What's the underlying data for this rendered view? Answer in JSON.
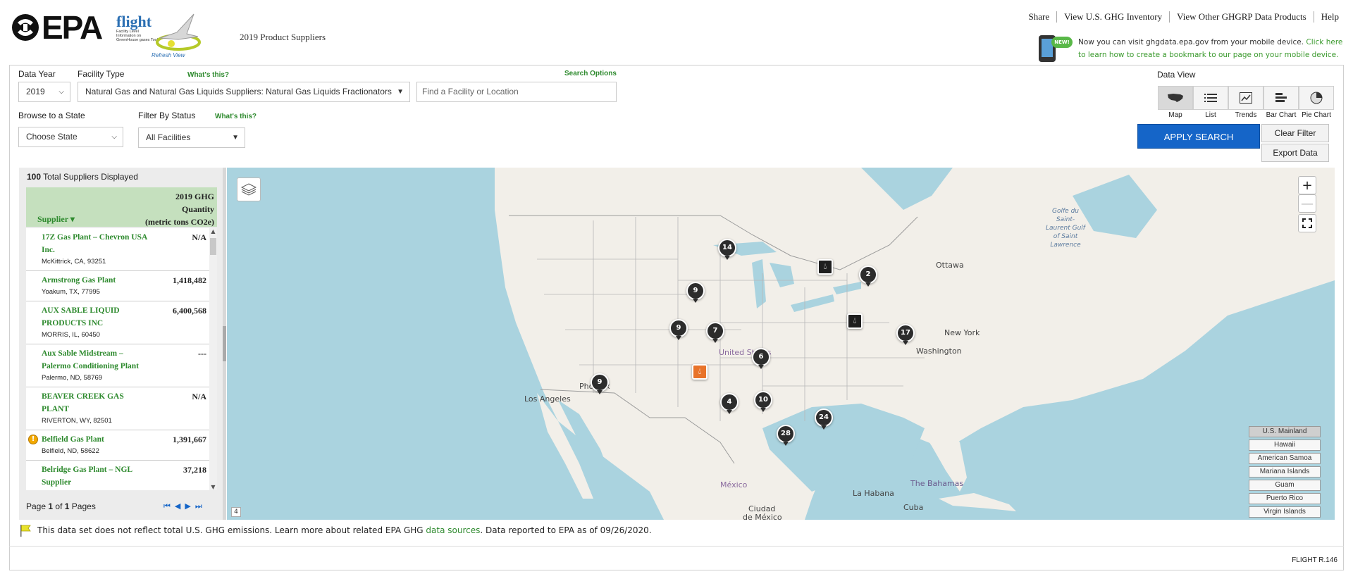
{
  "header": {
    "epa_text": "EPA",
    "flight_word": "flight",
    "flight_subtitle": "Facility Level Information on GreenHouse gases Tool",
    "refresh_view": "Refresh View",
    "page_title": "2019 Product Suppliers",
    "links": [
      "Share",
      "View U.S. GHG Inventory",
      "View Other GHGRP Data Products",
      "Help"
    ],
    "mobile_badge": "NEW!",
    "mobile_text": "Now you can visit ghgdata.epa.gov from your mobile device.",
    "mobile_link": "Click here to learn how to create a bookmark to our page on your mobile device."
  },
  "filters": {
    "data_year_label": "Data Year",
    "data_year_value": "2019",
    "facility_type_label": "Facility Type",
    "whats_this": "What's this?",
    "facility_type_value": "Natural Gas and Natural Gas Liquids Suppliers: Natural Gas Liquids Fractionators",
    "search_options": "Search Options",
    "search_placeholder": "Find a Facility or Location",
    "browse_state_label": "Browse to a State",
    "browse_state_value": "Choose State",
    "filter_status_label": "Filter By Status",
    "filter_status_value": "All Facilities",
    "data_view_label": "Data View",
    "views": [
      "Map",
      "List",
      "Trends",
      "Bar Chart",
      "Pie Chart"
    ],
    "active_view": "Map",
    "apply_label": "APPLY SEARCH",
    "clear_label": "Clear Filter",
    "export_label": "Export Data"
  },
  "list": {
    "count": "100",
    "count_suffix": "Total Suppliers Displayed",
    "supplier_header": "Supplier",
    "qty_header_1": "2019 GHG",
    "qty_header_2": "Quantity",
    "qty_header_3": "(metric tons CO2e)",
    "rows": [
      {
        "name": "17Z Gas Plant – Chevron USA Inc.",
        "loc": "McKittrick, CA, 93251",
        "qty": "N/A",
        "warn": false
      },
      {
        "name": "Armstrong Gas Plant",
        "loc": "Yoakum, TX, 77995",
        "qty": "1,418,482",
        "warn": false
      },
      {
        "name": "AUX SABLE LIQUID PRODUCTS INC",
        "loc": "MORRIS, IL, 60450",
        "qty": "6,400,568",
        "warn": false
      },
      {
        "name": "Aux Sable Midstream – Palermo Conditioning Plant",
        "loc": "Palermo, ND, 58769",
        "qty": "---",
        "warn": false
      },
      {
        "name": "BEAVER CREEK GAS PLANT",
        "loc": "RIVERTON, WY, 82501",
        "qty": "N/A",
        "warn": false
      },
      {
        "name": "Belfield Gas Plant",
        "loc": "Belfield, ND, 58622",
        "qty": "1,391,667",
        "warn": true
      },
      {
        "name": "Belridge Gas Plant – NGL Supplier",
        "loc": "",
        "qty": "37,218",
        "warn": false
      }
    ],
    "page_label": "Page",
    "page_current": "1",
    "page_of": "of",
    "page_total": "1",
    "pages_label": "Pages"
  },
  "map": {
    "labels": {
      "ottawa": "Ottawa",
      "newyork": "New York",
      "washington": "Washington",
      "unitedstates": "United States",
      "phoenix": "Phoenix",
      "losangeles": "Los Angeles",
      "mexico": "México",
      "ciudad": "Ciudad",
      "demexico": "de México",
      "lahabana": "La Habana",
      "bahamas": "The Bahamas",
      "cuba": "Cuba",
      "golfe": "Golfe du Saint-Laurent Gulf of Saint Lawrence"
    },
    "clusters": [
      "14",
      "9",
      "2",
      "9",
      "7",
      "17",
      "6",
      "9",
      "4",
      "10",
      "24",
      "28"
    ],
    "zoom_level": "4",
    "regions": [
      "U.S. Mainland",
      "Hawaii",
      "American Samoa",
      "Mariana Islands",
      "Guam",
      "Puerto Rico",
      "Virgin Islands"
    ],
    "active_region": "U.S. Mainland"
  },
  "footer": {
    "disclaimer_1": "This data set does not reflect total U.S. GHG emissions. Learn more about related EPA GHG",
    "data_sources": "data sources",
    "disclaimer_2": ". Data reported to EPA as of 09/26/2020.",
    "version": "FLIGHT R.146"
  },
  "colors": {
    "accent_green": "#2e8a2e",
    "apply_blue": "#1565c8",
    "map_water": "#aad3df",
    "map_land": "#f2efe9"
  }
}
